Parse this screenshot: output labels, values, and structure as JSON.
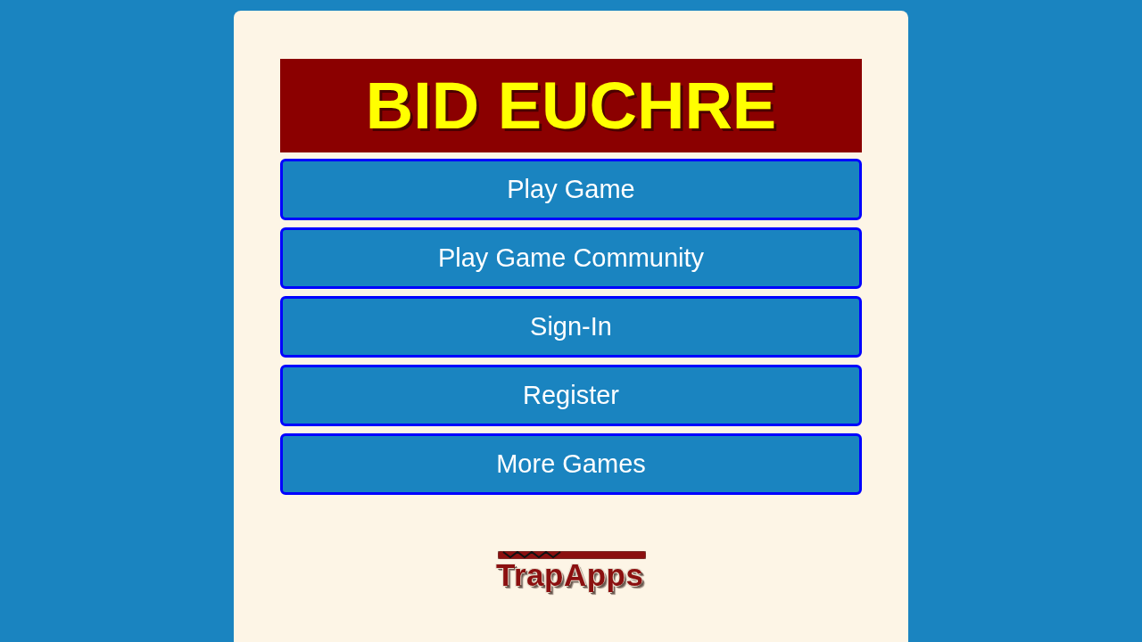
{
  "title": "BID EUCHRE",
  "menu_buttons": [
    "Play Game",
    "Play Game Community",
    "Sign-In",
    "Register",
    "More Games"
  ],
  "logo": {
    "text": "TrapApps"
  }
}
